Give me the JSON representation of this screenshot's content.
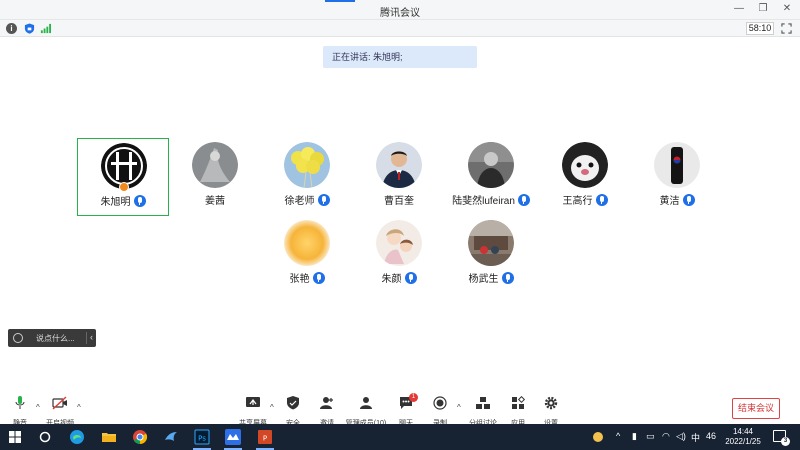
{
  "window": {
    "title": "腾讯会议"
  },
  "status": {
    "timer": "58:10"
  },
  "speaking": {
    "label": "正在讲话: 朱旭明;"
  },
  "participants": [
    {
      "name": "朱旭明"
    },
    {
      "name": "姜茜"
    },
    {
      "name": "徐老师"
    },
    {
      "name": "曹百奎"
    },
    {
      "name": "陆斐然lufeiran"
    },
    {
      "name": "王高行"
    },
    {
      "name": "黄洁"
    },
    {
      "name": "张艳"
    },
    {
      "name": "朱颜"
    },
    {
      "name": "杨武生"
    }
  ],
  "chat": {
    "placeholder": "说点什么..."
  },
  "toolbar": {
    "mute": "静音",
    "video": "开启视频",
    "share": "共享屏幕",
    "security": "安全",
    "invite": "邀请",
    "members": "管理成员(10)",
    "chat": "聊天",
    "chat_badge": "1",
    "record": "录制",
    "breakout": "分组讨论",
    "apps": "应用",
    "settings": "设置",
    "end": "结束会议"
  },
  "taskbar": {
    "ime": "中",
    "tray_num": "46",
    "time": "14:44",
    "date": "2022/1/25",
    "notif_count": "3"
  },
  "colors": {
    "accent": "#1e6fe8",
    "active_border": "#27b24a",
    "end": "#d13438",
    "taskbar": "#172233"
  }
}
